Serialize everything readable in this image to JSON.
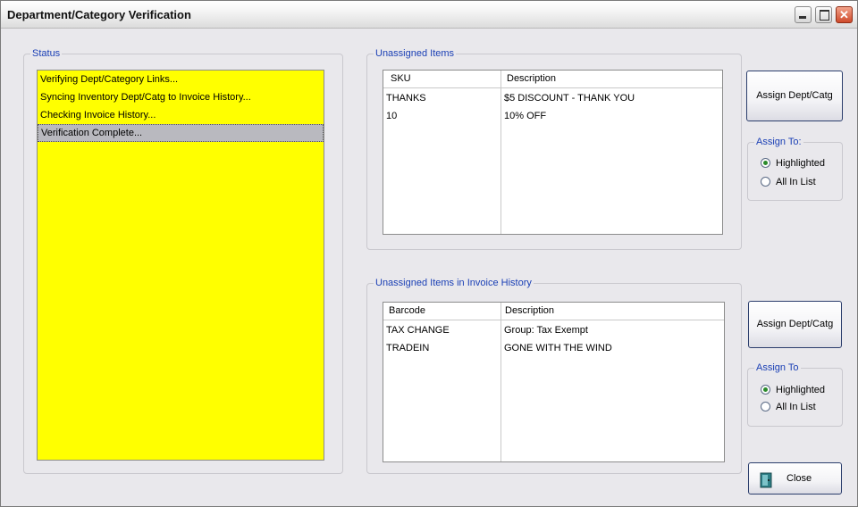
{
  "window": {
    "title": "Department/Category Verification"
  },
  "status_group": {
    "legend": "Status",
    "items": [
      "Verifying Dept/Category Links...",
      "Syncing Inventory Dept/Catg to Invoice History...",
      "Checking Invoice History...",
      "Verification Complete..."
    ]
  },
  "unassigned_items": {
    "legend": "Unassigned Items",
    "columns": [
      "SKU",
      "Description"
    ],
    "rows": [
      [
        "THANKS",
        "$5 DISCOUNT - THANK YOU"
      ],
      [
        "10",
        "10% OFF"
      ]
    ],
    "assign_button": "Assign Dept/Catg",
    "assign_to": {
      "legend": "Assign To:",
      "options": [
        "Highlighted",
        "All In List"
      ],
      "selected": "Highlighted"
    }
  },
  "invoice_history": {
    "legend": "Unassigned Items in Invoice History",
    "columns": [
      "Barcode",
      "Description"
    ],
    "rows": [
      [
        "TAX CHANGE",
        "Group: Tax Exempt"
      ],
      [
        "TRADEIN",
        "GONE WITH THE WIND"
      ]
    ],
    "assign_button": "Assign Dept/Catg",
    "assign_to": {
      "legend": "Assign To",
      "options": [
        "Highlighted",
        "All In List"
      ],
      "selected": "Highlighted"
    }
  },
  "close_button": "Close",
  "colors": {
    "status_bg": "#ffff00",
    "legend_text": "#1a3fb5",
    "window_bg": "#e9e8ec"
  }
}
